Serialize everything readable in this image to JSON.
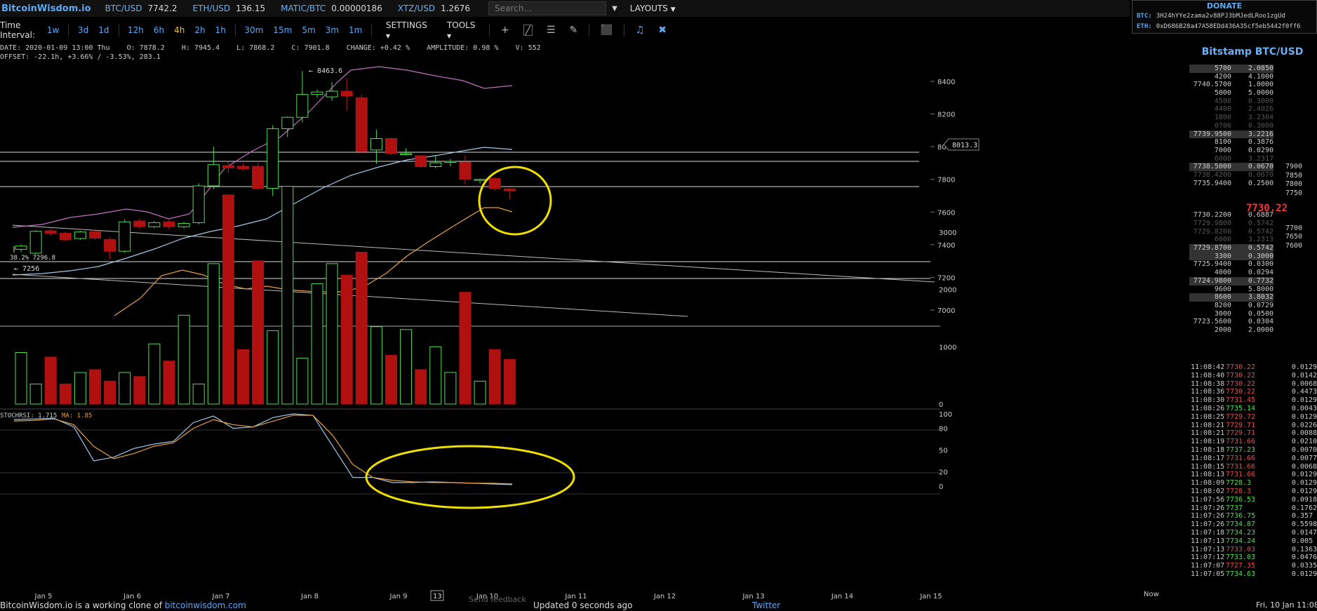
{
  "brand": "BitcoinWisdom.io",
  "tickers": [
    {
      "pair": "BTC/USD",
      "price": "7742.2"
    },
    {
      "pair": "ETH/USD",
      "price": "136.15"
    },
    {
      "pair": "MATIC/BTC",
      "price": "0.00000186"
    },
    {
      "pair": "XTZ/USD",
      "price": "1.2676"
    }
  ],
  "search": {
    "placeholder": "Search..."
  },
  "layouts_label": "LAYOUTS",
  "donate": {
    "title": "DONATE",
    "btc_label": "BTC:",
    "btc_addr": "3H24hYYe2zama2v88PJ3bMJedLRoo1zgUd",
    "eth_label": "ETH:",
    "eth_addr": "0xD686B28a47A58EDd436A35cf5eb5442f0ff6"
  },
  "toolbar": {
    "time_interval_label": "Time Interval:",
    "intervals": [
      "1w",
      "3d",
      "1d",
      "12h",
      "6h",
      "4h",
      "2h",
      "1h",
      "30m",
      "15m",
      "5m",
      "3m",
      "1m"
    ],
    "active_interval": "4h",
    "settings_label": "SETTINGS",
    "tools_label": "TOOLS"
  },
  "info": {
    "line1": "DATE: 2020-01-09 13:00 Thu    O: 7878.2    H: 7945.4    L: 7868.2    C: 7901.8    CHANGE: +0.42 %    AMPLITUDE: 0.98 %    V: 552",
    "line2": "OFFSET: -22.1h, +3.66% / -3.53%, 283.1"
  },
  "chart_data": {
    "type": "candlestick",
    "price_axis": {
      "ticks": [
        7000,
        7200,
        7400,
        7600,
        7800,
        8000,
        8200,
        8400
      ],
      "range": [
        6950,
        8510
      ]
    },
    "x_labels": [
      "Jan 5",
      "Jan 6",
      "Jan 7",
      "Jan 8",
      "Jan 9",
      "Jan 10",
      "Jan 11",
      "Jan 12",
      "Jan 13",
      "Jan 14",
      "Jan 15"
    ],
    "candles": [
      {
        "o": 7372,
        "c": 7392,
        "h": 7400,
        "l": 7355
      },
      {
        "o": 7348,
        "c": 7482,
        "h": 7490,
        "l": 7340
      },
      {
        "o": 7485,
        "c": 7470,
        "h": 7500,
        "l": 7455
      },
      {
        "o": 7470,
        "c": 7430,
        "h": 7480,
        "l": 7420
      },
      {
        "o": 7438,
        "c": 7478,
        "h": 7485,
        "l": 7430
      },
      {
        "o": 7480,
        "c": 7440,
        "h": 7495,
        "l": 7430
      },
      {
        "o": 7432,
        "c": 7360,
        "h": 7445,
        "l": 7310
      },
      {
        "o": 7360,
        "c": 7540,
        "h": 7555,
        "l": 7350
      },
      {
        "o": 7545,
        "c": 7510,
        "h": 7560,
        "l": 7495
      },
      {
        "o": 7510,
        "c": 7535,
        "h": 7545,
        "l": 7500
      },
      {
        "o": 7540,
        "c": 7510,
        "h": 7560,
        "l": 7495
      },
      {
        "o": 7510,
        "c": 7530,
        "h": 7540,
        "l": 7500
      },
      {
        "o": 7535,
        "c": 7760,
        "h": 7775,
        "l": 7525
      },
      {
        "o": 7760,
        "c": 7890,
        "h": 8000,
        "l": 7740
      },
      {
        "o": 7885,
        "c": 7870,
        "h": 7905,
        "l": 7840
      },
      {
        "o": 7880,
        "c": 7865,
        "h": 7895,
        "l": 7855
      },
      {
        "o": 7880,
        "c": 7745,
        "h": 7900,
        "l": 7735
      },
      {
        "o": 7745,
        "c": 8110,
        "h": 8130,
        "l": 7700
      },
      {
        "o": 8110,
        "c": 8180,
        "h": 8185,
        "l": 8060
      },
      {
        "o": 8180,
        "c": 8320,
        "h": 8463.6,
        "l": 8150
      },
      {
        "o": 8320,
        "c": 8335,
        "h": 8350,
        "l": 8300
      },
      {
        "o": 8305,
        "c": 8340,
        "h": 8395,
        "l": 8280
      },
      {
        "o": 8340,
        "c": 8310,
        "h": 8420,
        "l": 8220
      },
      {
        "o": 8300,
        "c": 7970,
        "h": 8320,
        "l": 7960
      },
      {
        "o": 7980,
        "c": 8050,
        "h": 8105,
        "l": 7895
      },
      {
        "o": 8050,
        "c": 7958,
        "h": 8055,
        "l": 7950
      },
      {
        "o": 7955,
        "c": 7958,
        "h": 7990,
        "l": 7945
      },
      {
        "o": 7945,
        "c": 7878,
        "h": 7945,
        "l": 7870
      },
      {
        "o": 7878.2,
        "c": 7901.8,
        "h": 7945.4,
        "l": 7868.2
      },
      {
        "o": 7905,
        "c": 7910,
        "h": 7925,
        "l": 7880
      },
      {
        "o": 7905,
        "c": 7800,
        "h": 7945,
        "l": 7770
      },
      {
        "o": 7800,
        "c": 7800,
        "h": 7805,
        "l": 7775
      },
      {
        "o": 7805,
        "c": 7745,
        "h": 7815,
        "l": 7730
      },
      {
        "o": 7742,
        "c": 7730,
        "h": 7745,
        "l": 7680
      }
    ],
    "volume": {
      "ticks": [
        0,
        1000,
        2000,
        3000
      ],
      "max": 3900,
      "values": [
        900,
        350,
        820,
        350,
        550,
        600,
        400,
        550,
        480,
        1050,
        750,
        1550,
        350,
        2450,
        3650,
        950,
        2500,
        1280,
        3800,
        800,
        2100,
        2450,
        2250,
        2650,
        1350,
        850,
        1300,
        600,
        1000,
        552,
        1950,
        400,
        950,
        780
      ]
    },
    "stochrsi": {
      "label": "STOCHRSI: 1.715",
      "ma_label": "MA: 1.85",
      "ticks": [
        0,
        20,
        50,
        80,
        100
      ],
      "k": [
        92,
        93,
        94,
        82,
        35,
        40,
        52,
        58,
        62,
        88,
        97,
        80,
        82,
        95,
        100,
        98,
        55,
        12,
        12,
        5,
        5,
        6,
        5,
        4,
        3,
        2
      ],
      "d": [
        90,
        91,
        93,
        85,
        55,
        38,
        45,
        55,
        60,
        80,
        92,
        85,
        82,
        90,
        98,
        98,
        70,
        30,
        12,
        8,
        6,
        5,
        5,
        4,
        4,
        3
      ]
    },
    "annotations": {
      "high_label": "8463.6",
      "fib_label": "38.2% 7296.8",
      "low_label": "7256",
      "cursor_price": "8013.3",
      "crosshair_x_label": "13"
    }
  },
  "orderbook": {
    "title": "Bitstamp BTC/USD",
    "asks": [
      {
        "p": "5700",
        "a": "2.0850",
        "hl": true
      },
      {
        "p": "4200",
        "a": "4.1000"
      },
      {
        "p": "7740.5700",
        "a": "1.0000"
      },
      {
        "p": "5000",
        "a": "5.0000"
      },
      {
        "p": "4500",
        "a": "0.3000",
        "dim": true
      },
      {
        "p": "4400",
        "a": "2.4026",
        "dim": true
      },
      {
        "p": "1800",
        "a": "3.2304",
        "dim": true
      },
      {
        "p": "0700",
        "a": "0.3000",
        "dim": true
      },
      {
        "p": "7739.9500",
        "a": "3.2216",
        "hl": true
      },
      {
        "p": "8100",
        "a": "0.3876"
      },
      {
        "p": "7000",
        "a": "0.0290"
      },
      {
        "p": "6000",
        "a": "3.2317",
        "dim": true
      },
      {
        "p": "7738.5000",
        "a": "0.0670",
        "hl": true
      },
      {
        "p": "7738.4200",
        "a": "0.0670",
        "dim": true
      },
      {
        "p": "7735.9400",
        "a": "0.2500"
      }
    ],
    "last": "7730.22",
    "bids": [
      {
        "p": "7730.2200",
        "a": "0.6887"
      },
      {
        "p": "7729.9800",
        "a": "0.5742",
        "dim": true
      },
      {
        "p": "7729.8200",
        "a": "0.5742",
        "dim": true
      },
      {
        "p": "6000",
        "a": "3.2313",
        "dim": true
      },
      {
        "p": "7729.8700",
        "a": "0.5742",
        "hl": true
      },
      {
        "p": "3300",
        "a": "0.3000",
        "hl": true
      },
      {
        "p": "7725.9400",
        "a": "0.0300"
      },
      {
        "p": "4000",
        "a": "0.0294"
      },
      {
        "p": "7724.9800",
        "a": "0.7732",
        "hl": true
      },
      {
        "p": "9600",
        "a": "5.8000"
      },
      {
        "p": "8600",
        "a": "3.8032",
        "hl": true
      },
      {
        "p": "8200",
        "a": "0.0729"
      },
      {
        "p": "3000",
        "a": "0.0500"
      },
      {
        "p": "7723.5600",
        "a": "0.0304"
      },
      {
        "p": "2000",
        "a": "2.0000"
      }
    ],
    "depth_scale": [
      "7900",
      "7850",
      "7800",
      "7750",
      "",
      "",
      "",
      "7700",
      "7650",
      "7600"
    ]
  },
  "trades": [
    {
      "t": "11:08:42",
      "p": "7730.22",
      "a": "0.0129"
    },
    {
      "t": "11:08:40",
      "p": "7730.22",
      "a": "0.0142"
    },
    {
      "t": "11:08:38",
      "p": "7730.22",
      "a": "0.0068"
    },
    {
      "t": "11:08:36",
      "p": "7730.22",
      "a": "0.4473"
    },
    {
      "t": "11:08:30",
      "p": "7731.45",
      "a": "0.0129"
    },
    {
      "t": "11:08:26",
      "p": "7735.14",
      "a": "0.0043",
      "up": true
    },
    {
      "t": "11:08:25",
      "p": "7729.72",
      "a": "0.0129"
    },
    {
      "t": "11:08:21",
      "p": "7729.71",
      "a": "0.0226"
    },
    {
      "t": "11:08:21",
      "p": "7729.71",
      "a": "0.0088"
    },
    {
      "t": "11:08:19",
      "p": "7731.66",
      "a": "0.0210"
    },
    {
      "t": "11:08:18",
      "p": "7737.23",
      "a": "0.0070",
      "up": true
    },
    {
      "t": "11:08:17",
      "p": "7731.66",
      "a": "0.0077"
    },
    {
      "t": "11:08:15",
      "p": "7731.66",
      "a": "0.0068"
    },
    {
      "t": "11:08:13",
      "p": "7731.66",
      "a": "0.0129"
    },
    {
      "t": "11:08:09",
      "p": "7728.3",
      "a": "0.0129",
      "up": true
    },
    {
      "t": "11:08:02",
      "p": "7728.3",
      "a": "0.0129"
    },
    {
      "t": "11:07:56",
      "p": "7736.53",
      "a": "0.0918",
      "up": true
    },
    {
      "t": "11:07:26",
      "p": "7737",
      "a": "0.1762",
      "up": true
    },
    {
      "t": "11:07:26",
      "p": "7736.75",
      "a": "0.357",
      "up": true
    },
    {
      "t": "11:07:26",
      "p": "7734.87",
      "a": "0.5598",
      "up": true
    },
    {
      "t": "11:07:18",
      "p": "7734.23",
      "a": "0.0147",
      "up": true
    },
    {
      "t": "11:07:13",
      "p": "7734.24",
      "a": "0.005",
      "up": true
    },
    {
      "t": "11:07:13",
      "p": "7733.03",
      "a": "0.1363"
    },
    {
      "t": "11:07:12",
      "p": "7733.03",
      "a": "0.0476",
      "up": true
    },
    {
      "t": "11:07:07",
      "p": "7727.35",
      "a": "0.0335"
    },
    {
      "t": "11:07:05",
      "p": "7734.63",
      "a": "0.0129",
      "up": true
    }
  ],
  "footer": {
    "left_text": "BitcoinWisdom.io is a working clone of ",
    "left_link": "bitcoinwisdom.com",
    "updated": "Updated 0 seconds ago",
    "twitter": "Twitter",
    "right": "Fri, 10 Jan 11:08",
    "now": "Now",
    "feedback": "Send feedback"
  },
  "colors": {
    "up": "#50e050",
    "down": "#b01010",
    "ma_fast": "#e8a040",
    "ma_slow": "#a0c8e8",
    "band": "#c070c0",
    "highlight": "#f0e000"
  }
}
